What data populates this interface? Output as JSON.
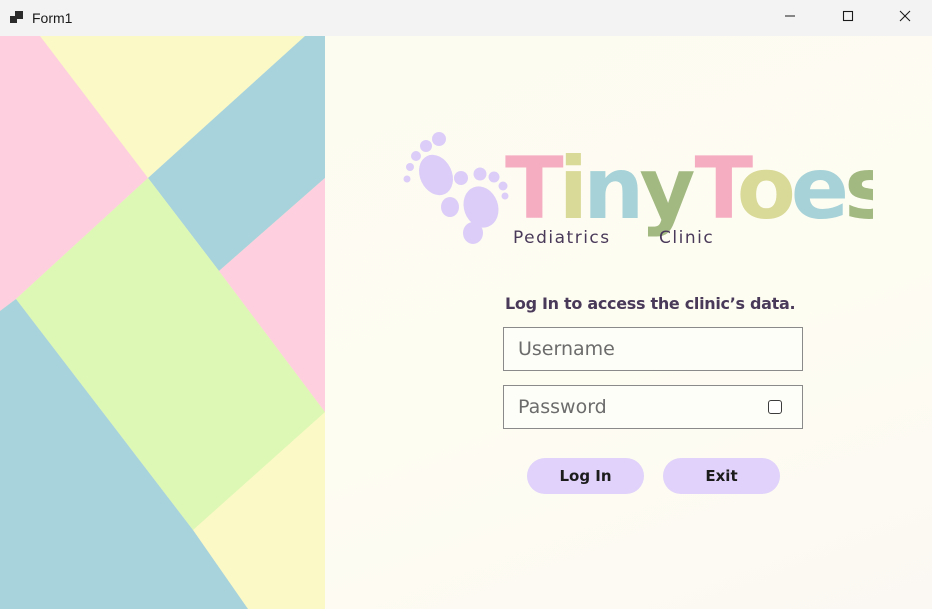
{
  "window": {
    "title": "Form1",
    "icons": {
      "app": "app-window-icon",
      "minimize": "minimize-icon",
      "maximize": "maximize-icon",
      "close": "close-icon"
    }
  },
  "branding": {
    "logo_word_1": "Tiny",
    "logo_word_2": "Toes",
    "subtitle_1": "Pediatrics",
    "subtitle_2": "Clinic",
    "icon": "baby-footprints-icon",
    "colors": {
      "pink": "#f5adc2",
      "khaki": "#d9d998",
      "blue": "#a7d2d8",
      "green": "#a3b982",
      "lavender": "#dccdf8"
    }
  },
  "login": {
    "prompt": "Log In to access the clinic’s data.",
    "username_placeholder": "Username",
    "password_placeholder": "Password",
    "login_label": "Log In",
    "exit_label": "Exit"
  },
  "theme": {
    "button_bg": "#e0d2fa",
    "panel_bg": "#fefdf2",
    "geo_pink": "#fdcfdf",
    "geo_yellow": "#fbf9c6",
    "geo_blue": "#a8d3dc",
    "geo_green": "#ddf8b5"
  }
}
